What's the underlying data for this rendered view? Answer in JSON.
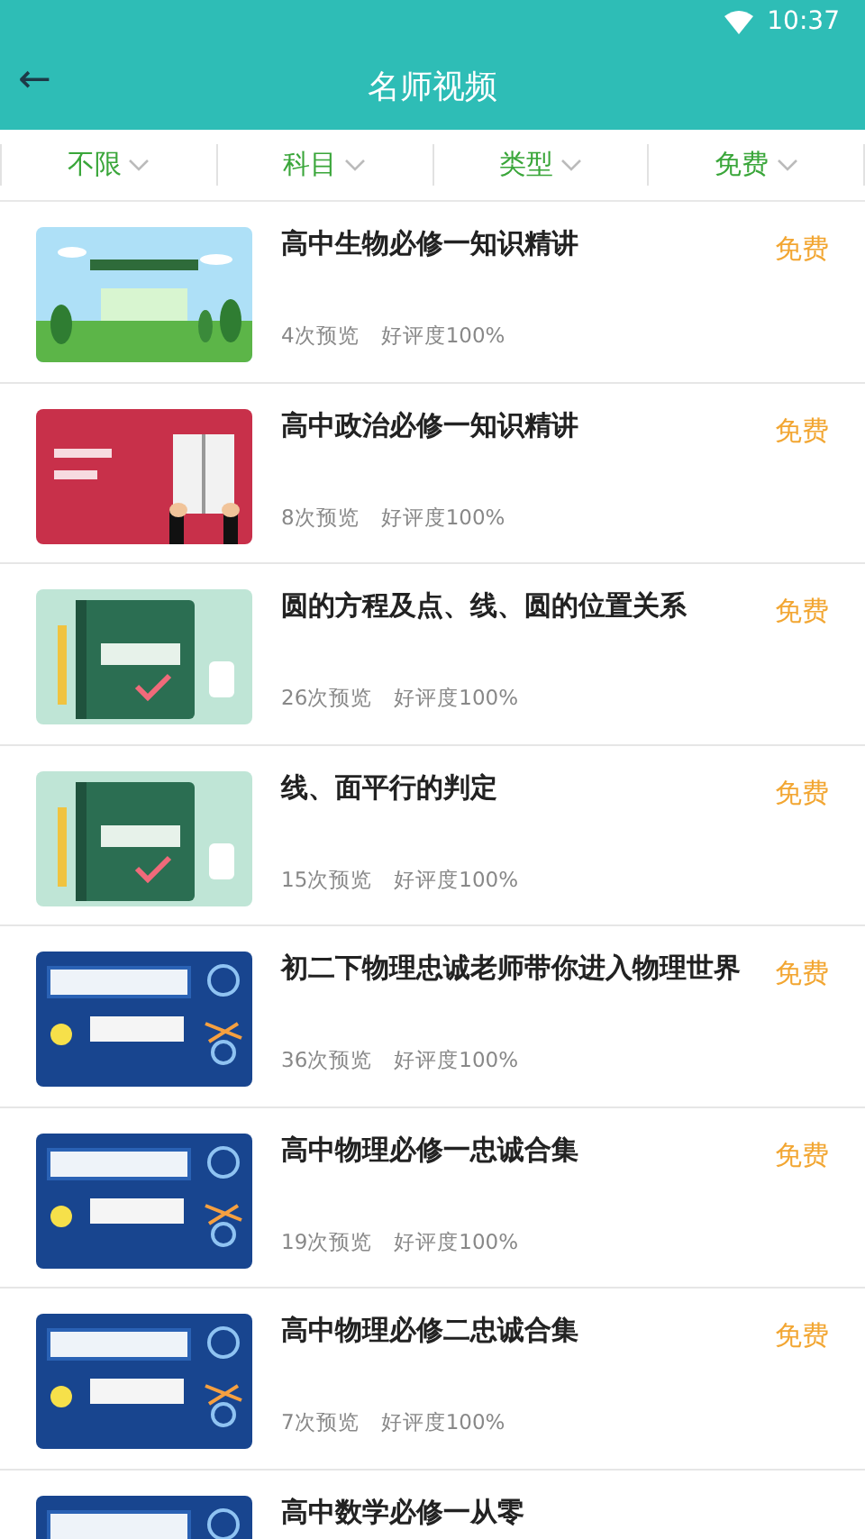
{
  "status_bar": {
    "time": "10:37"
  },
  "header": {
    "back": "←",
    "title": "名师视频"
  },
  "filters": [
    {
      "label": "不限",
      "selected": false
    },
    {
      "label": "科目",
      "selected": false
    },
    {
      "label": "类型",
      "selected": false
    },
    {
      "label": "免费",
      "selected": false
    }
  ],
  "videos": [
    {
      "title": "高中生物必修一知识精讲",
      "views": "4次预览",
      "rating": "好评度100%",
      "price": "免费"
    },
    {
      "title": "高中政治必修一知识精讲",
      "views": "8次预览",
      "rating": "好评度100%",
      "price": "免费"
    },
    {
      "title": "圆的方程及点、线、圆的位置关系",
      "views": "26次预览",
      "rating": "好评度100%",
      "price": "免费"
    },
    {
      "title": "线、面平行的判定",
      "views": "15次预览",
      "rating": "好评度100%",
      "price": "免费"
    },
    {
      "title": "初二下物理忠诚老师带你进入物理世界",
      "views": "36次预览",
      "rating": "好评度100%",
      "price": "免费"
    },
    {
      "title": "高中物理必修一忠诚合集",
      "views": "19次预览",
      "rating": "好评度100%",
      "price": "免费"
    },
    {
      "title": "高中物理必修二忠诚合集",
      "views": "7次预览",
      "rating": "好评度100%",
      "price": "免费"
    },
    {
      "title": "高中数学必修一从零"
    }
  ]
}
